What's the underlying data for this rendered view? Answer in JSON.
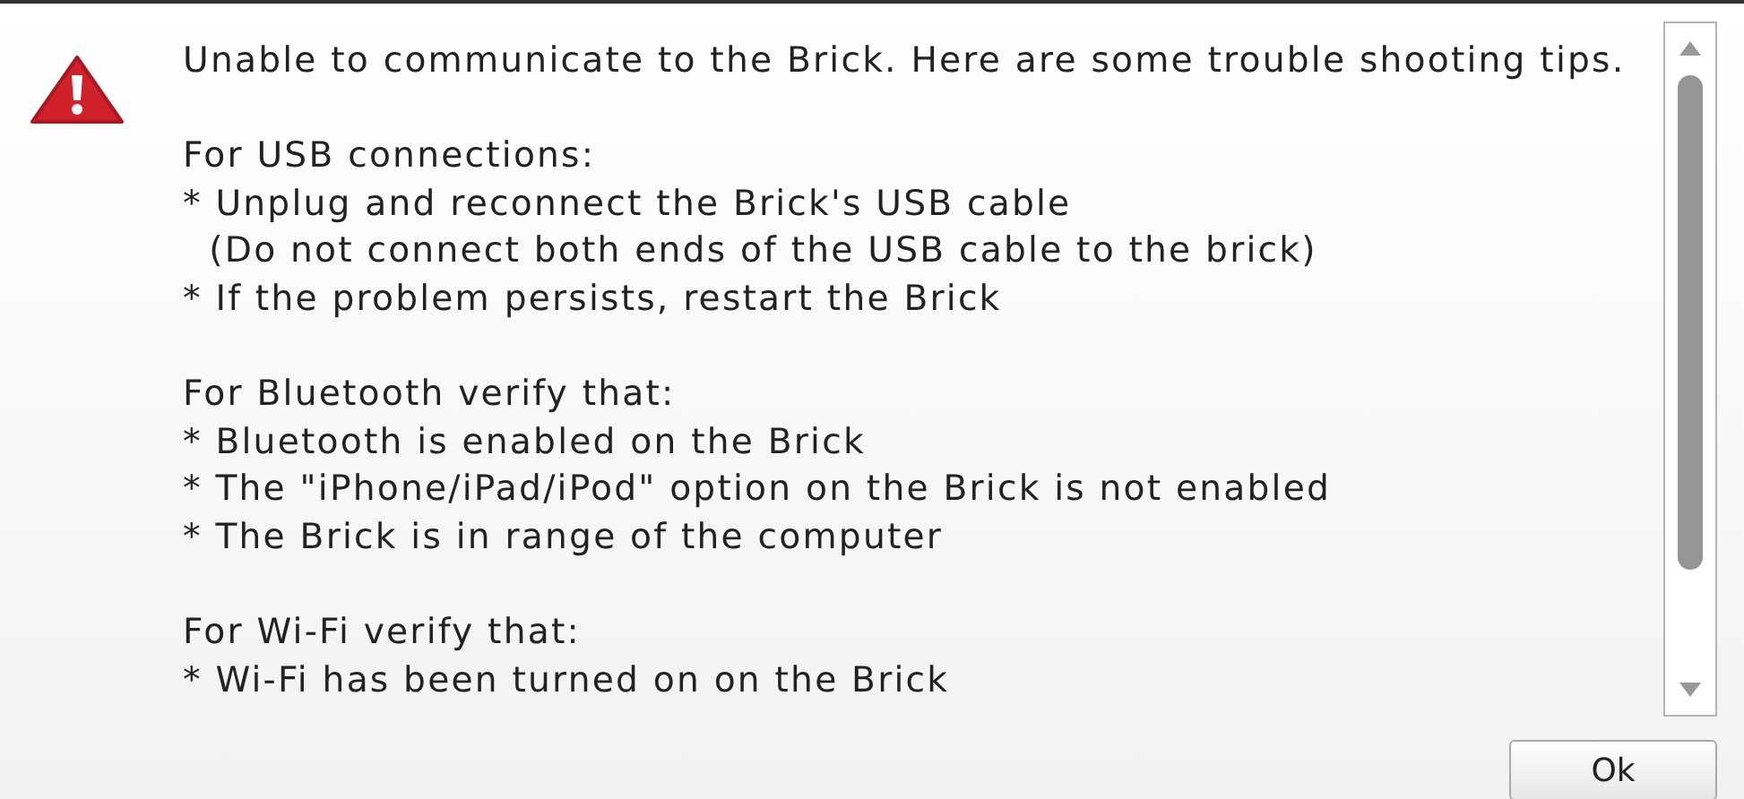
{
  "message": {
    "paragraphs": [
      [
        "Unable to communicate to the Brick. Here are some trouble shooting tips."
      ],
      [
        "For USB connections:",
        "* Unplug and reconnect the Brick's USB cable",
        "  (Do not connect both ends of the USB cable to the brick)",
        "* If the problem persists, restart the Brick"
      ],
      [
        "For Bluetooth verify that:",
        "* Bluetooth is enabled on the Brick",
        "* The \"iPhone/iPad/iPod\" option on the Brick is not enabled",
        "* The Brick is in range of the computer"
      ],
      [
        "For Wi-Fi verify that:",
        "* Wi-Fi has been turned on on the Brick"
      ]
    ]
  },
  "buttons": [
    {
      "label": "Ok"
    }
  ]
}
